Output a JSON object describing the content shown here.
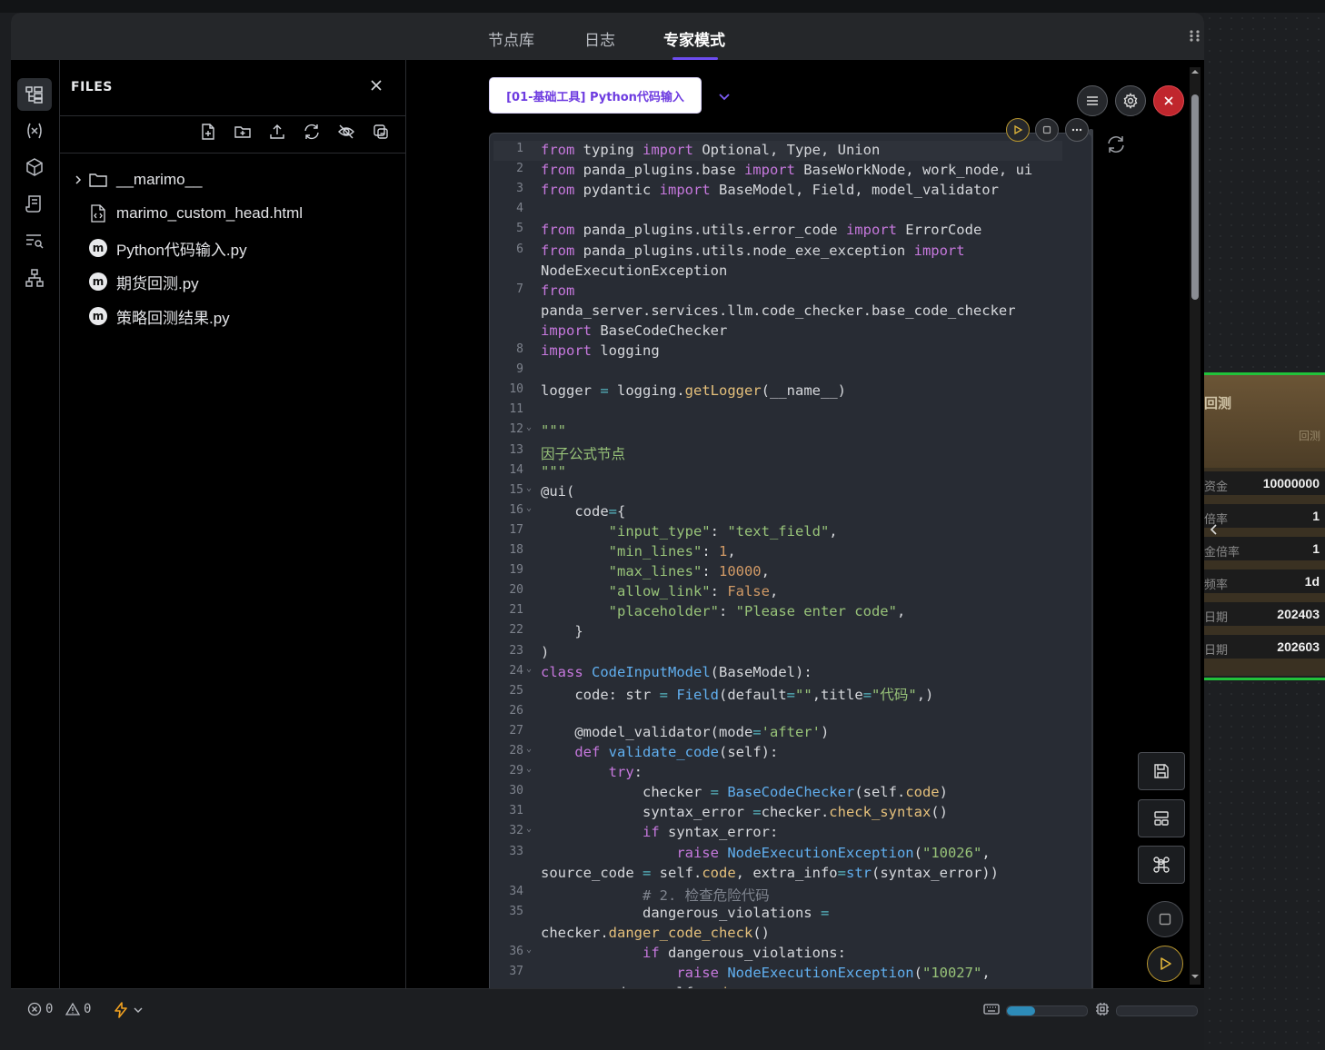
{
  "header": {
    "tabs": [
      {
        "label": "节点库"
      },
      {
        "label": "日志"
      },
      {
        "label": "专家模式"
      }
    ]
  },
  "files": {
    "title": "FILES",
    "items": [
      {
        "name": "__marimo__",
        "type": "folder"
      },
      {
        "name": "marimo_custom_head.html",
        "type": "html"
      },
      {
        "name": "Python代码输入.py",
        "type": "marimo"
      },
      {
        "name": "期货回测.py",
        "type": "marimo"
      },
      {
        "name": "策略回测结果.py",
        "type": "marimo"
      }
    ],
    "marimo_badge": "m"
  },
  "node": {
    "title": "[01-基础工具] Python代码输入"
  },
  "status": {
    "errors": "0",
    "warnings": "0",
    "kbd_progress": 0.35,
    "cpu_progress": 0.0
  },
  "canvas_node": {
    "title": "回测",
    "subtitle": "回测",
    "rows": [
      {
        "label": "资金",
        "value": "10000000"
      },
      {
        "label": "倍率",
        "value": "1"
      },
      {
        "label": "金倍率",
        "value": "1"
      },
      {
        "label": "频率",
        "value": "1d"
      },
      {
        "label": "日期",
        "value": "202403"
      },
      {
        "label": "日期",
        "value": "202603"
      }
    ]
  },
  "colors": {
    "accent": "#6d4cf0",
    "close_red": "#c0262d",
    "run_gold": "#b8962e",
    "node_green": "#21c23a"
  },
  "code": [
    {
      "n": "1",
      "f": "",
      "html": "<span class='kw'>from</span> typing <span class='kw'>import</span> Optional, Type, Union"
    },
    {
      "n": "2",
      "f": "",
      "html": "<span class='kw'>from</span> panda_plugins.base <span class='kw'>import</span> BaseWorkNode, work_node, ui"
    },
    {
      "n": "3",
      "f": "",
      "html": "<span class='kw'>from</span> pydantic <span class='kw'>import</span> BaseModel, Field, model_validator"
    },
    {
      "n": "4",
      "f": "",
      "html": ""
    },
    {
      "n": "5",
      "f": "",
      "html": "<span class='kw'>from</span> panda_plugins.utils.error_code <span class='kw'>import</span> ErrorCode"
    },
    {
      "n": "6",
      "f": "",
      "html": "<span class='kw'>from</span> panda_plugins.utils.node_exe_exception <span class='kw'>import</span>"
    },
    {
      "n": "",
      "f": "",
      "html": "NodeExecutionException"
    },
    {
      "n": "7",
      "f": "",
      "html": "<span class='kw'>from</span>"
    },
    {
      "n": "",
      "f": "",
      "html": "panda_server.services.llm.code_checker.base_code_checker"
    },
    {
      "n": "",
      "f": "",
      "html": "<span class='kw'>import</span> BaseCodeChecker"
    },
    {
      "n": "8",
      "f": "",
      "html": "<span class='kw'>import</span> logging"
    },
    {
      "n": "9",
      "f": "",
      "html": ""
    },
    {
      "n": "10",
      "f": "",
      "html": "logger <span class='op'>=</span> logging.<span class='fn'>getLogger</span>(__name__)"
    },
    {
      "n": "11",
      "f": "",
      "html": ""
    },
    {
      "n": "12",
      "f": "⌄",
      "html": "<span class='str'>\"\"\"</span>"
    },
    {
      "n": "13",
      "f": "",
      "html": "<span class='str'>因子公式节点</span>"
    },
    {
      "n": "14",
      "f": "",
      "html": "<span class='str'>\"\"\"</span>"
    },
    {
      "n": "15",
      "f": "⌄",
      "html": "@ui("
    },
    {
      "n": "16",
      "f": "⌄",
      "html": "    code<span class='op'>=</span>{"
    },
    {
      "n": "17",
      "f": "",
      "html": "        <span class='str'>\"input_type\"</span>: <span class='str'>\"text_field\"</span>,"
    },
    {
      "n": "18",
      "f": "",
      "html": "        <span class='str'>\"min_lines\"</span>: <span class='num'>1</span>,"
    },
    {
      "n": "19",
      "f": "",
      "html": "        <span class='str'>\"max_lines\"</span>: <span class='num'>10000</span>,"
    },
    {
      "n": "20",
      "f": "",
      "html": "        <span class='str'>\"allow_link\"</span>: <span class='num'>False</span>,"
    },
    {
      "n": "21",
      "f": "",
      "html": "        <span class='str'>\"placeholder\"</span>: <span class='str'>\"Please enter code\"</span>,"
    },
    {
      "n": "22",
      "f": "",
      "html": "    }"
    },
    {
      "n": "23",
      "f": "",
      "html": ")"
    },
    {
      "n": "24",
      "f": "⌄",
      "html": "<span class='kw'>class</span> <span class='cls'>CodeInputModel</span>(BaseModel):"
    },
    {
      "n": "25",
      "f": "",
      "html": "    code: str <span class='op'>=</span> <span class='cls'>Field</span>(default<span class='op'>=</span><span class='str'>\"\"</span>,title<span class='op'>=</span><span class='str'>\"代码\"</span>,)"
    },
    {
      "n": "26",
      "f": "",
      "html": ""
    },
    {
      "n": "27",
      "f": "",
      "html": "    @model_validator(mode<span class='op'>=</span><span class='str'>'after'</span>)"
    },
    {
      "n": "28",
      "f": "⌄",
      "html": "    <span class='kw'>def</span> <span class='cls'>validate_code</span>(self):"
    },
    {
      "n": "29",
      "f": "⌄",
      "html": "        <span class='kw'>try</span>:"
    },
    {
      "n": "30",
      "f": "",
      "html": "            checker <span class='op'>=</span> <span class='cls'>BaseCodeChecker</span>(self.<span class='attr'>code</span>)"
    },
    {
      "n": "31",
      "f": "",
      "html": "            syntax_error <span class='op'>=</span>checker.<span class='fn'>check_syntax</span>()"
    },
    {
      "n": "32",
      "f": "⌄",
      "html": "            <span class='kw'>if</span> syntax_error:"
    },
    {
      "n": "33",
      "f": "",
      "html": "                <span class='kw'>raise</span> <span class='cls'>NodeExecutionException</span>(<span class='str'>\"10026\"</span>,"
    },
    {
      "n": "",
      "f": "",
      "html": "source_code <span class='op'>=</span> self.<span class='attr'>code</span>, extra_info<span class='op'>=</span><span class='cls'>str</span>(syntax_error))"
    },
    {
      "n": "34",
      "f": "",
      "html": "            <span class='cmt'># 2. 检查危险代码</span>"
    },
    {
      "n": "35",
      "f": "",
      "html": "            dangerous_violations <span class='op'>=</span>"
    },
    {
      "n": "",
      "f": "",
      "html": "checker.<span class='fn'>danger_code_check</span>()"
    },
    {
      "n": "36",
      "f": "⌄",
      "html": "            <span class='kw'>if</span> dangerous_violations:"
    },
    {
      "n": "37",
      "f": "",
      "html": "                <span class='kw'>raise</span> <span class='cls'>NodeExecutionException</span>(<span class='str'>\"10027\"</span>,"
    },
    {
      "n": "",
      "f": "",
      "html": "source_code <span class='op'>=</span> self.<span class='attr'>code</span>,"
    }
  ]
}
